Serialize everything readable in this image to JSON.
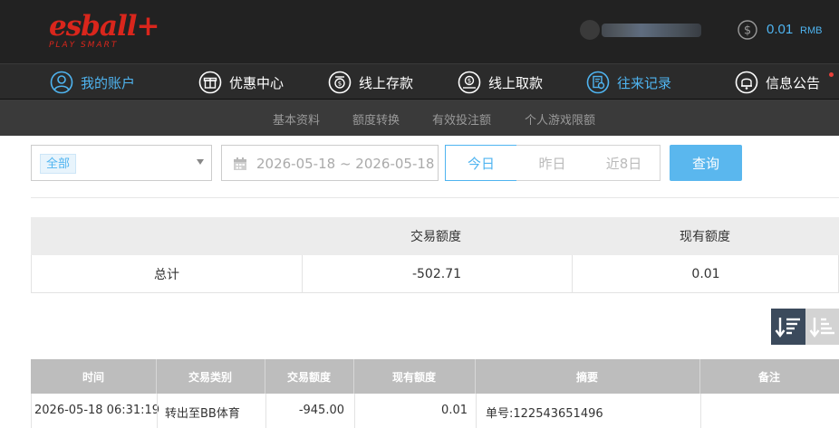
{
  "header": {
    "logo_text": "esball+",
    "logo_tagline": "PLAY SMART",
    "balance_value": "0.01",
    "balance_unit": "RMB"
  },
  "main_nav": [
    {
      "label": "我的账户",
      "icon": "user-icon",
      "state": "active"
    },
    {
      "label": "优惠中心",
      "icon": "gift-icon",
      "state": "normal"
    },
    {
      "label": "线上存款",
      "icon": "deposit-icon",
      "state": "normal"
    },
    {
      "label": "线上取款",
      "icon": "withdraw-icon",
      "state": "normal"
    },
    {
      "label": "往来记录",
      "icon": "records-icon",
      "state": "highlighted"
    },
    {
      "label": "信息公告",
      "icon": "bell-icon",
      "state": "normal"
    }
  ],
  "sub_nav": [
    "基本资料",
    "额度转换",
    "有效投注额",
    "个人游戏限额"
  ],
  "filter": {
    "category_selected": "全部",
    "date_range": "2026-05-18 ~ 2026-05-18",
    "quick_ranges": [
      "今日",
      "昨日",
      "近8日"
    ],
    "active_range": "今日",
    "query_label": "查询"
  },
  "summary": {
    "headers": [
      "",
      "交易额度",
      "现有额度"
    ],
    "row": {
      "label": "总计",
      "transaction_amount": "-502.71",
      "current_balance": "0.01"
    }
  },
  "details": {
    "headers": [
      "时间",
      "交易类别",
      "交易额度",
      "现有额度",
      "摘要",
      "备注"
    ],
    "rows": [
      {
        "time": "2026-05-18 06:31:19",
        "type": "转出至BB体育",
        "amount": "-945.00",
        "balance": "0.01",
        "summary": "单号:122543651496",
        "remark": ""
      }
    ]
  },
  "colors": {
    "accent": "#4fb4f0",
    "brand_red": "#d9261c",
    "header_bg": "#222222",
    "query_button": "#5ab7ee",
    "sort_active": "#3b4a5c"
  }
}
